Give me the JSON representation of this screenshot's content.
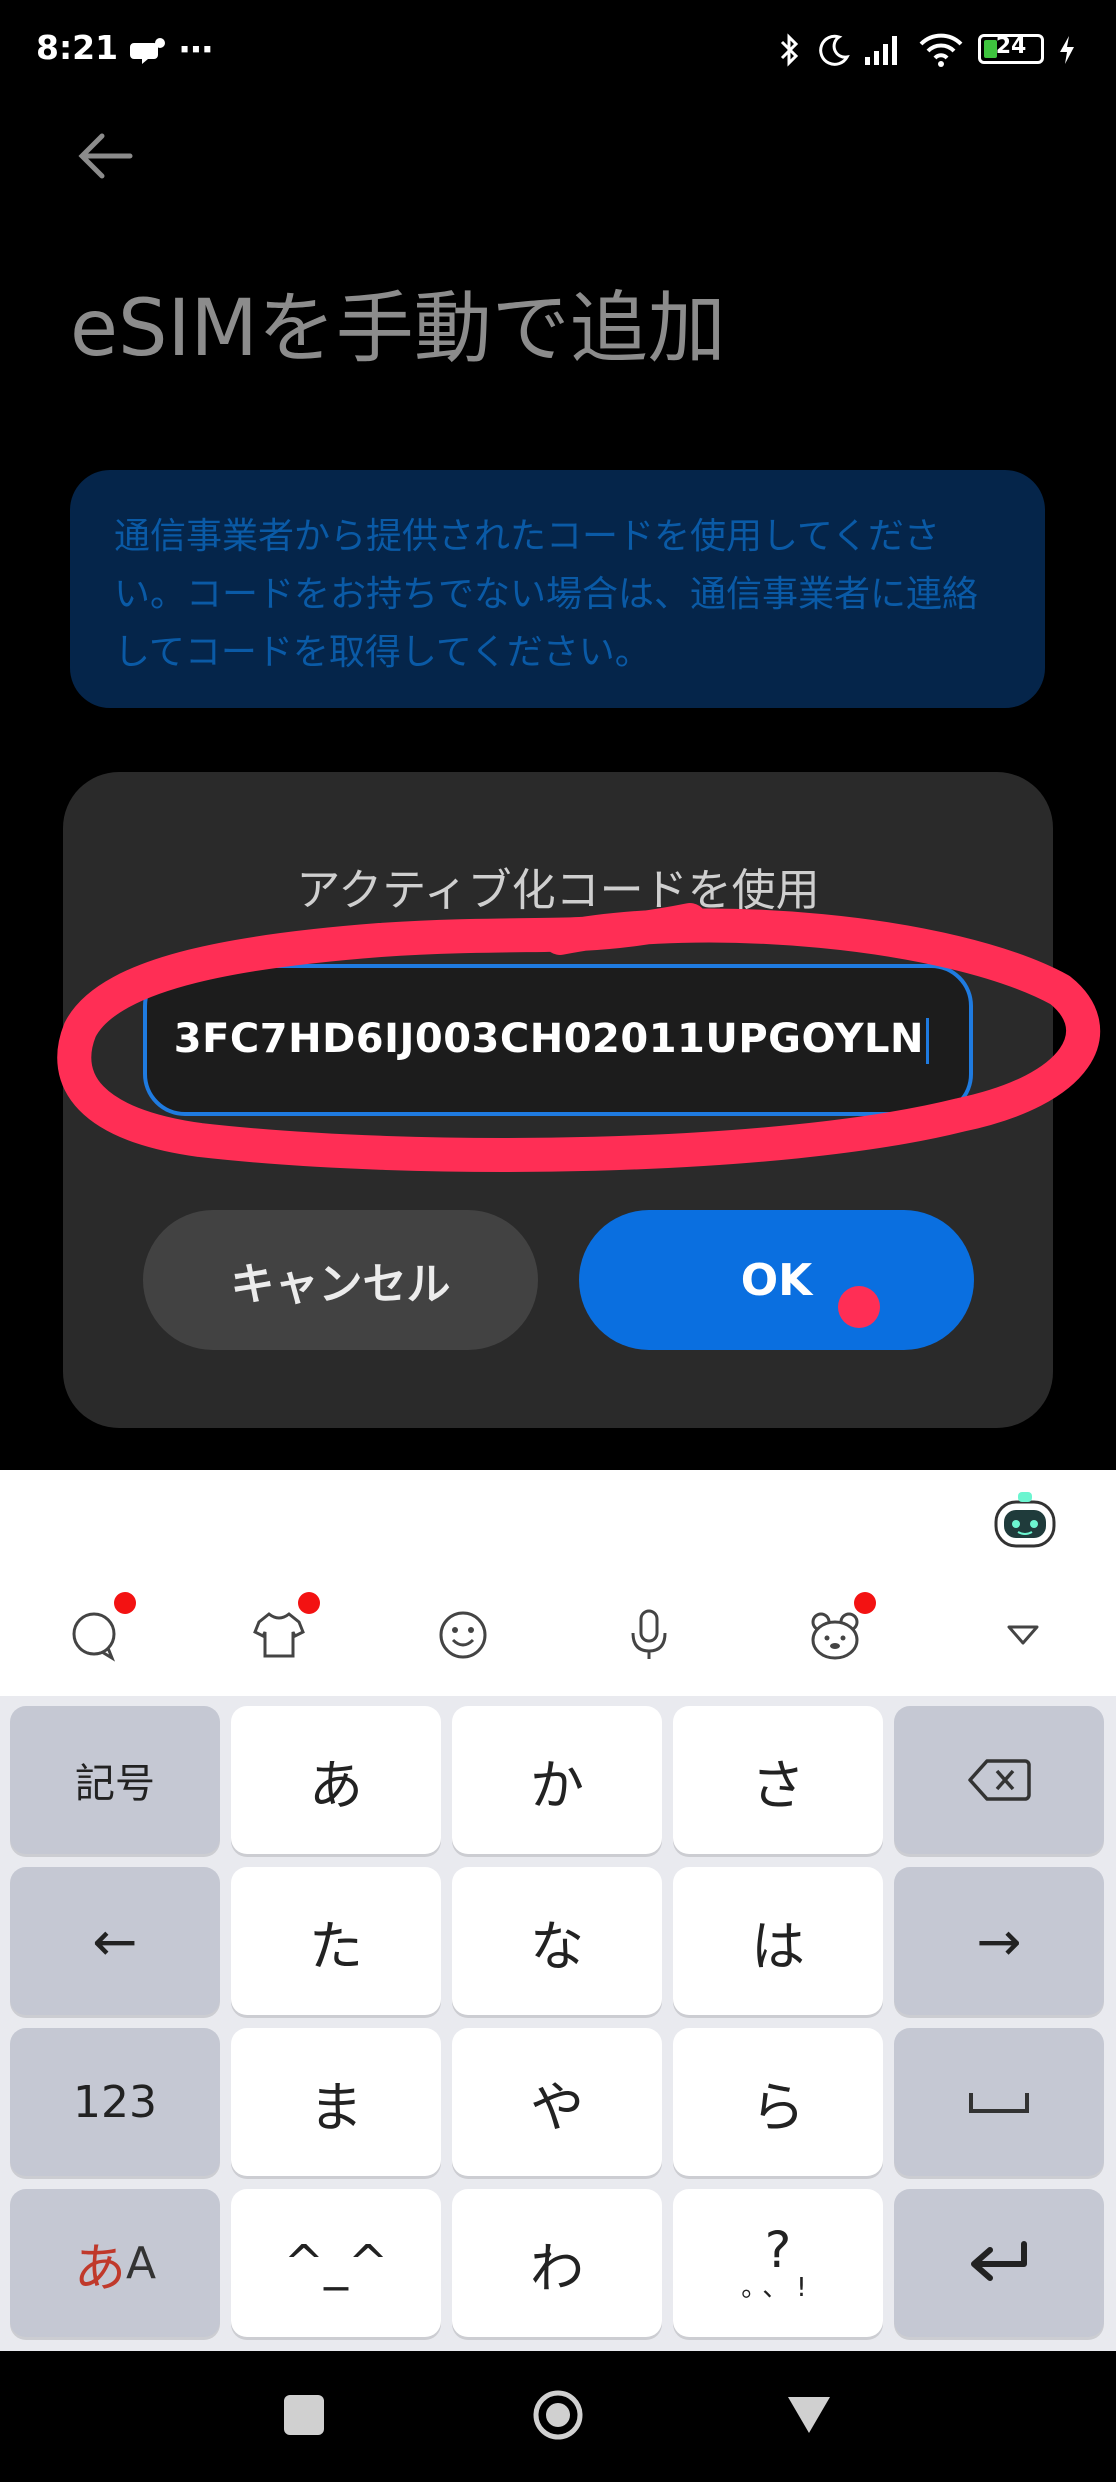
{
  "status_bar": {
    "time": "8:21",
    "battery_level": "24",
    "battery_fill_percent": 24,
    "icons": [
      "app-notification-icon",
      "more-dots-icon",
      "bluetooth-icon",
      "moon-icon",
      "signal-icon",
      "wifi-icon",
      "battery-icon",
      "charging-icon"
    ]
  },
  "page": {
    "title": "eSIMを手動で追加",
    "info": "通信事業者から提供されたコードを使用してください。コードをお持ちでない場合は、通信事業者に連絡してコードを取得してください。"
  },
  "dialog": {
    "title": "アクティブ化コードを使用",
    "code_value": "3FC7HD6IJ003CH02011UPGOYLN",
    "cancel_label": "キャンセル",
    "ok_label": "OK"
  },
  "keyboard": {
    "toolbar_icons": [
      "chat-icon",
      "shirt-icon",
      "emoji-icon",
      "microphone-icon",
      "bear-sticker-icon",
      "collapse-keyboard-icon"
    ],
    "rows": [
      [
        "記号",
        "あ",
        "か",
        "さ",
        "⌫"
      ],
      [
        "←",
        "た",
        "な",
        "は",
        "→"
      ],
      [
        "123",
        "ま",
        "や",
        "ら",
        "␣"
      ],
      [
        "あA",
        "^_^",
        "わ",
        "?。、!",
        "↵"
      ]
    ],
    "mode_kana": "あ",
    "mode_latin": "A",
    "punct_main": "?",
    "punct_sub": "。、!"
  },
  "colors": {
    "accent": "#0a6fe0",
    "annotation": "#ff2e55",
    "info_text": "#0a5aa6"
  }
}
